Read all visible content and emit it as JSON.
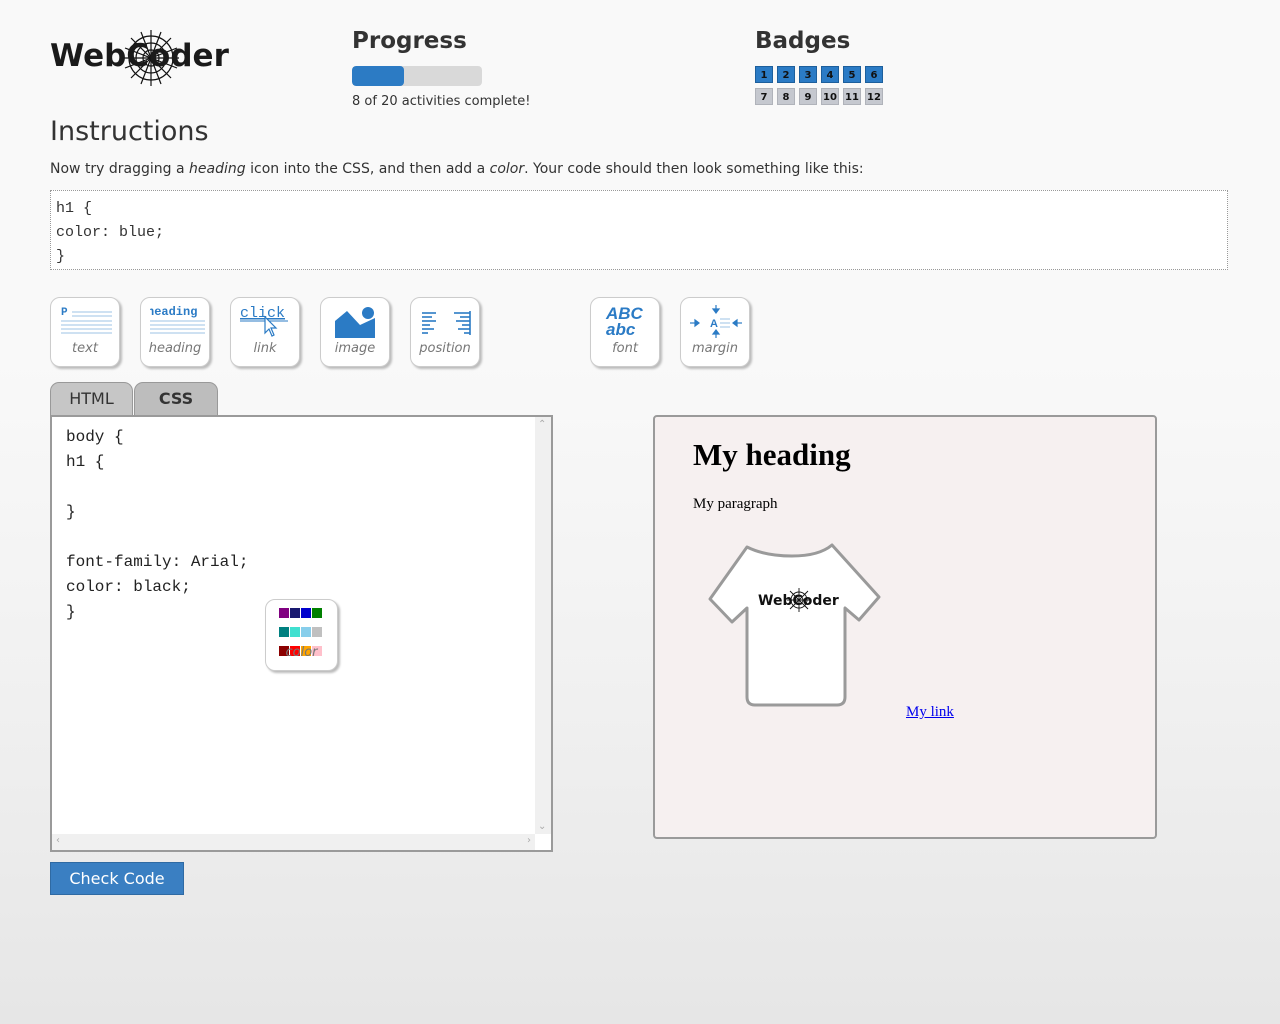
{
  "logo": {
    "text": "WebCoder"
  },
  "progress": {
    "title": "Progress",
    "completed": 8,
    "total": 20,
    "status_text": "8 of 20 activities complete!",
    "fill_fraction": 0.4,
    "bar_color": "#2c7bc4"
  },
  "badges": {
    "title": "Badges",
    "items": [
      {
        "label": "1",
        "earned": true
      },
      {
        "label": "2",
        "earned": true
      },
      {
        "label": "3",
        "earned": true
      },
      {
        "label": "4",
        "earned": true
      },
      {
        "label": "5",
        "earned": true
      },
      {
        "label": "6",
        "earned": true
      },
      {
        "label": "7",
        "earned": false
      },
      {
        "label": "8",
        "earned": false
      },
      {
        "label": "9",
        "earned": false
      },
      {
        "label": "10",
        "earned": false
      },
      {
        "label": "11",
        "earned": false
      },
      {
        "label": "12",
        "earned": false
      }
    ],
    "earned_color": "#2b7bc5",
    "locked_color": "#c5c8cf"
  },
  "instructions": {
    "title": "Instructions",
    "text_parts": [
      "Now try dragging a ",
      "heading",
      " icon into the CSS, and then add a ",
      "color",
      ". Your code should then look something like this:"
    ],
    "code_lines": [
      "h1 {",
      "color: blue;",
      "}"
    ]
  },
  "tools": [
    {
      "name": "text",
      "label": "text",
      "icon": "paragraph-icon",
      "icon_text": "P"
    },
    {
      "name": "heading",
      "label": "heading",
      "icon": "heading-icon",
      "icon_text": "heading"
    },
    {
      "name": "link",
      "label": "link",
      "icon": "link-icon",
      "icon_text": "click"
    },
    {
      "name": "image",
      "label": "image",
      "icon": "image-icon"
    },
    {
      "name": "position",
      "label": "position",
      "icon": "align-icon"
    },
    {
      "name": "font",
      "label": "font",
      "icon": "font-icon",
      "icon_text_top": "ABC",
      "icon_text_bottom": "abc"
    },
    {
      "name": "margin",
      "label": "margin",
      "icon": "margin-icon",
      "icon_text": "A"
    }
  ],
  "tabs": [
    {
      "label": "HTML",
      "active": false
    },
    {
      "label": "CSS",
      "active": true
    }
  ],
  "editor": {
    "lines": [
      "body {",
      "h1 {",
      "",
      "}",
      "",
      "font-family: Arial;",
      "color: black;",
      "}"
    ]
  },
  "color_tool": {
    "label": "color",
    "swatches": [
      "#800080",
      "#191970",
      "#0000cd",
      "#008000",
      "#008080",
      "#40e0d0",
      "#87ceeb",
      "#c0c0c0",
      "#8b0000",
      "#ff0000",
      "#ffa500",
      "#ffc0cb"
    ],
    "icon": "color-palette-icon"
  },
  "check_button": {
    "label": "Check Code",
    "color": "#3a7fc2"
  },
  "preview": {
    "heading": "My heading",
    "paragraph": "My paragraph",
    "shirt_logo_text": "WebCoder",
    "link": "My link",
    "background": "#f6f0f0"
  }
}
